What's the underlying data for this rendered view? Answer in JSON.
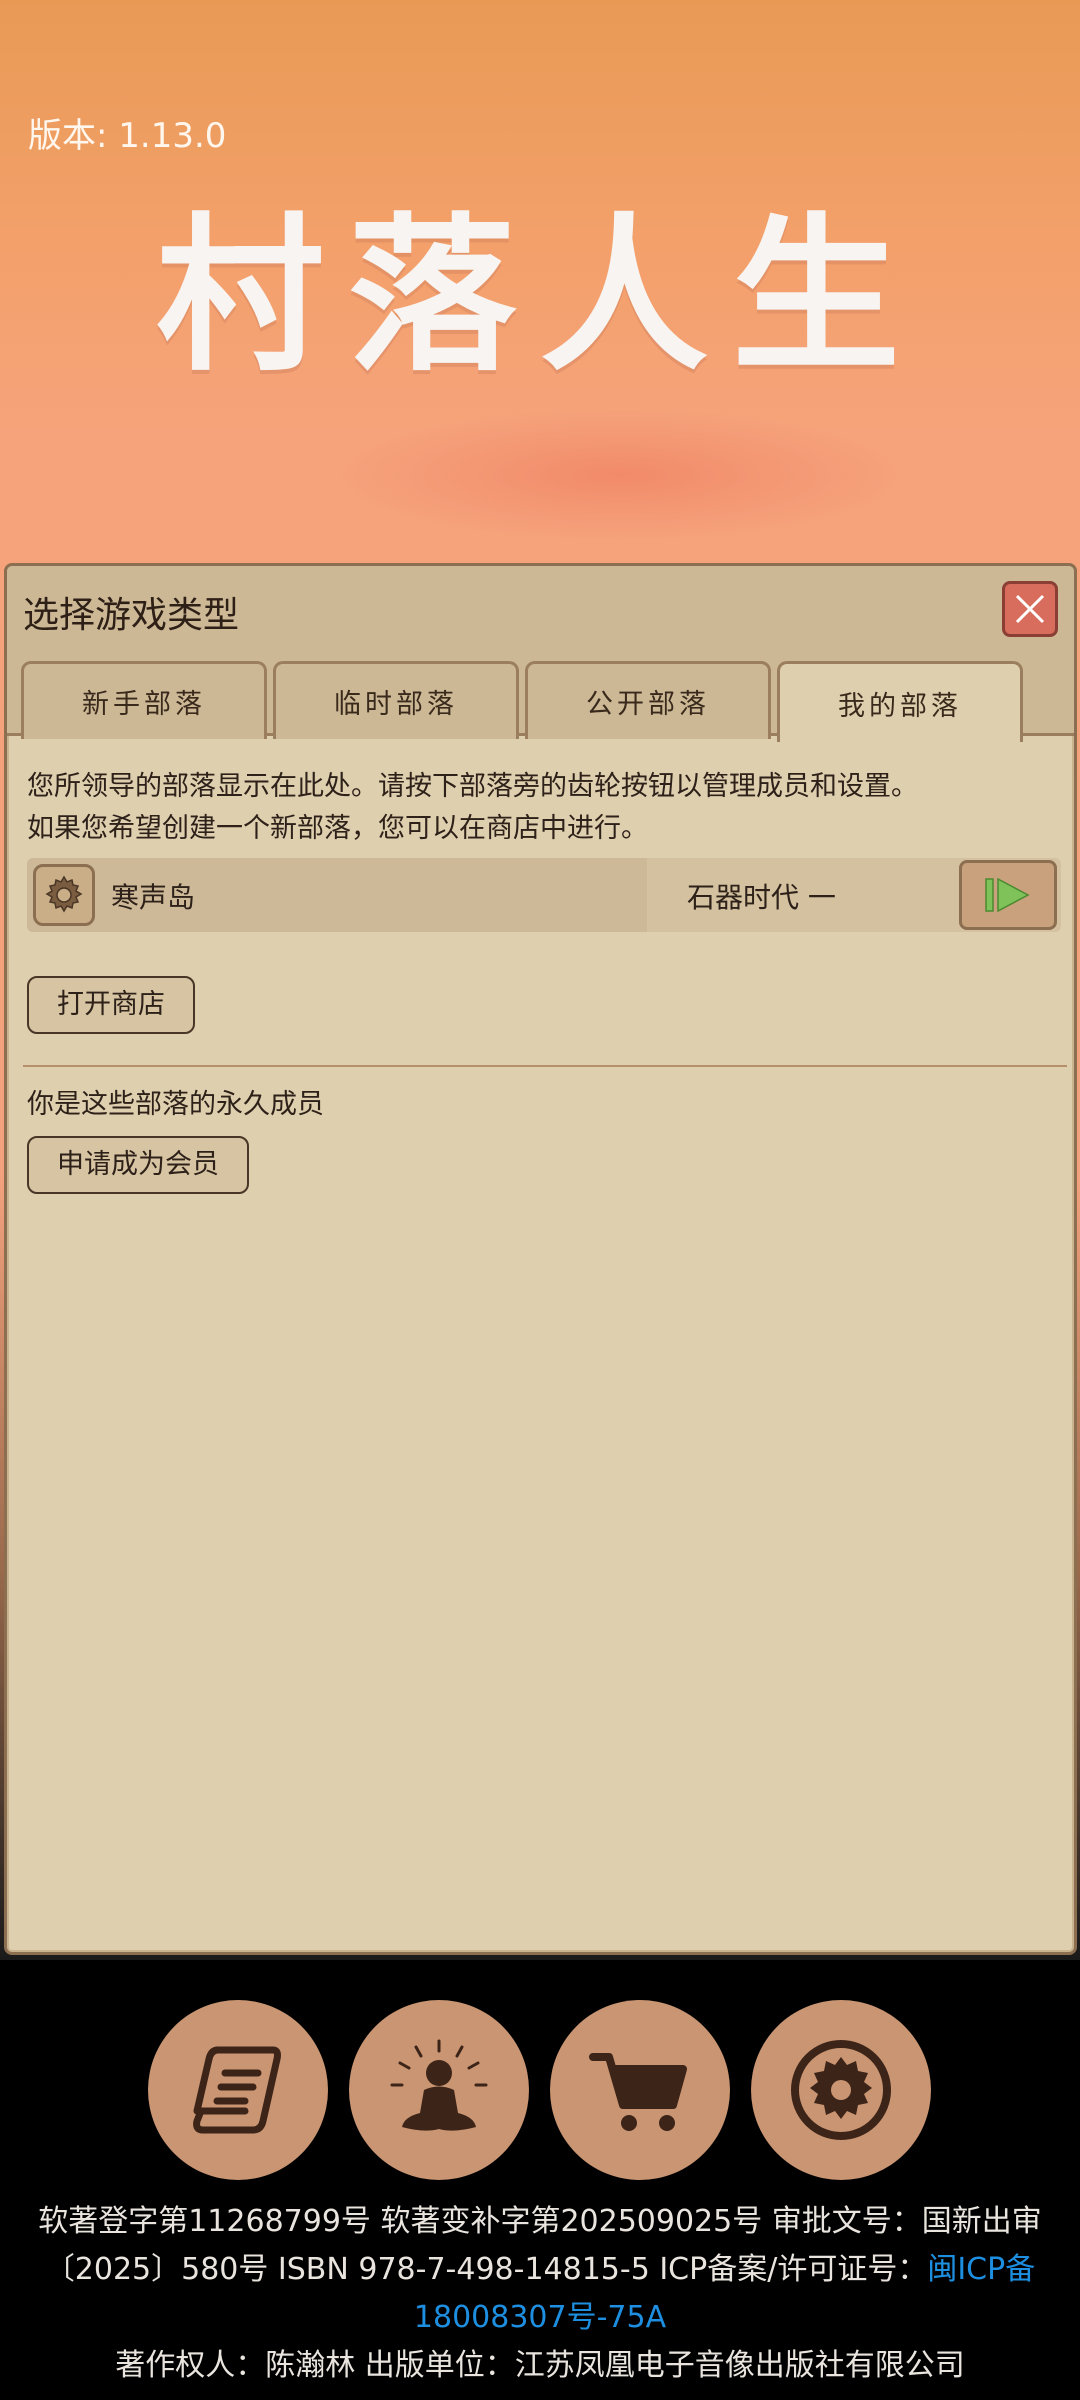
{
  "version": "版本: 1.13.0",
  "game_title": "村落人生",
  "dialog": {
    "title": "选择游戏类型",
    "tabs": [
      {
        "label": "新手部落",
        "active": false
      },
      {
        "label": "临时部落",
        "active": false
      },
      {
        "label": "公开部落",
        "active": false
      },
      {
        "label": "我的部落",
        "active": true
      }
    ],
    "info_line1": "您所领导的部落显示在此处。请按下部落旁的齿轮按钮以管理成员和设置。",
    "info_line2": "如果您希望创建一个新部落，您可以在商店中进行。",
    "tribe": {
      "name": "寒声岛",
      "era": "石器时代 一"
    },
    "open_shop_label": "打开商店",
    "member_text": "你是这些部落的永久成员",
    "apply_member_label": "申请成为会员"
  },
  "nav": {
    "icons": [
      "scroll-icon",
      "meditation-icon",
      "shopping-cart-icon",
      "settings-gear-icon"
    ]
  },
  "footer": {
    "line1": "软著登字第11268799号 软著变补字第202509025号 审批文号：国新出审",
    "line2_text": "〔2025〕580号 ISBN 978-7-498-14815-5 ICP备案/许可证号：",
    "line2_link": "闽ICP备",
    "line3_link": "18008307号-75A",
    "line4": "著作权人：陈瀚林 出版单位：江苏凤凰电子音像出版社有限公司"
  },
  "colors": {
    "dialog_bg": "#decfaf",
    "nav_button": "#c99572",
    "link": "#1e8fe0",
    "close_button": "#d86d5e"
  }
}
